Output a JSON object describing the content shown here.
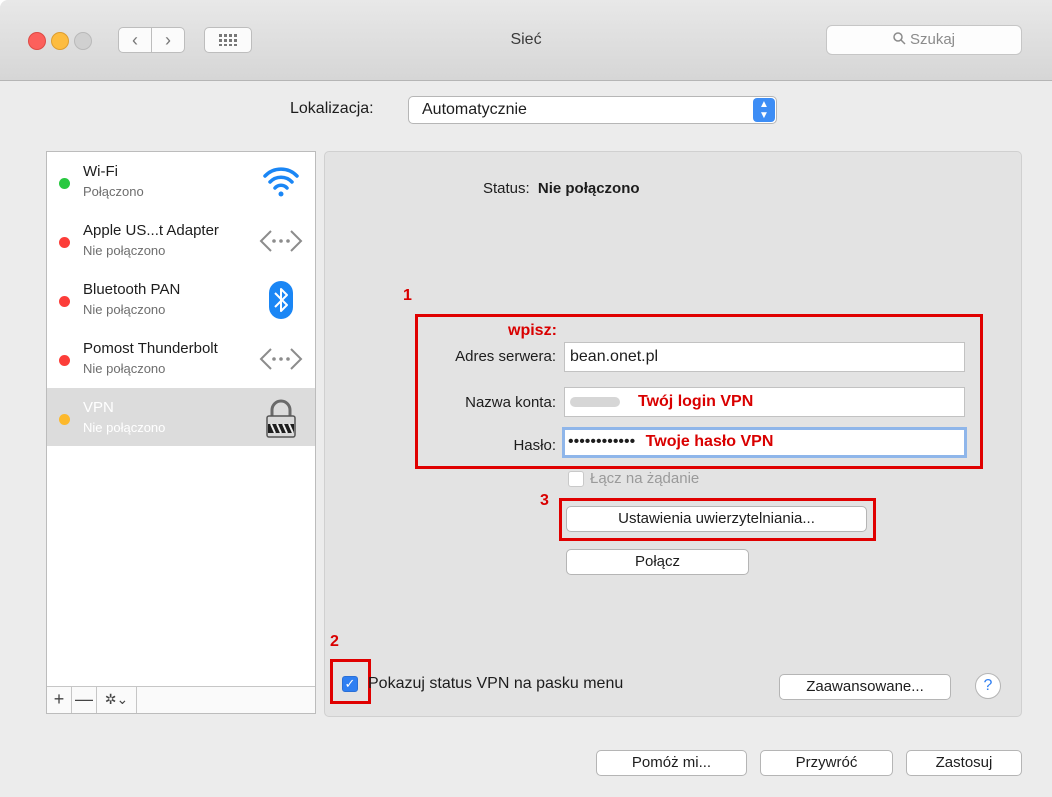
{
  "window": {
    "title": "Sieć"
  },
  "toolbar": {
    "back_icon": "chevron-left",
    "forward_icon": "chevron-right",
    "grid_icon": "grid",
    "search_placeholder": "Szukaj"
  },
  "location": {
    "label": "Lokalizacja:",
    "value": "Automatycznie"
  },
  "services": [
    {
      "name": "Wi-Fi",
      "status": "Połączono",
      "dot_color": "#28c840",
      "icon": "wifi-icon"
    },
    {
      "name": "Apple US...t Adapter",
      "status": "Nie połączono",
      "dot_color": "#fc3d39",
      "icon": "ethernet-icon"
    },
    {
      "name": "Bluetooth PAN",
      "status": "Nie połączono",
      "dot_color": "#fc3d39",
      "icon": "bluetooth-icon"
    },
    {
      "name": "Pomost Thunderbolt",
      "status": "Nie połączono",
      "dot_color": "#fc3d39",
      "icon": "thunderbolt-bridge-icon"
    },
    {
      "name": "VPN",
      "status": "Nie połączono",
      "dot_color": "#fdb92c",
      "icon": "lock-icon",
      "selected": true
    }
  ],
  "list_toolbar": {
    "add": "+",
    "remove": "—",
    "gear": "✲⌄"
  },
  "vpn": {
    "status_label": "Status:",
    "status_value": "Nie połączono",
    "server_label": "Adres serwera:",
    "server_value": "bean.onet.pl",
    "account_label": "Nazwa konta:",
    "password_label": "Hasło:",
    "password_dots": "••••••••••••",
    "on_demand_label": "Łącz na żądanie",
    "auth_button": "Ustawienia uwierzytelniania...",
    "connect_button": "Połącz",
    "show_status_label": "Pokazuj status VPN na pasku menu",
    "show_status_checked": true,
    "advanced_button": "Zaawansowane...",
    "help": "?"
  },
  "annotations": {
    "n1": "1",
    "n2": "2",
    "n3": "3",
    "enter": "wpisz:",
    "login_hint": "Twój login VPN",
    "password_hint": "Twoje hasło VPN",
    "color": "#e00000"
  },
  "footer": {
    "assist": "Pomóż mi...",
    "revert": "Przywróć",
    "apply": "Zastosuj"
  }
}
